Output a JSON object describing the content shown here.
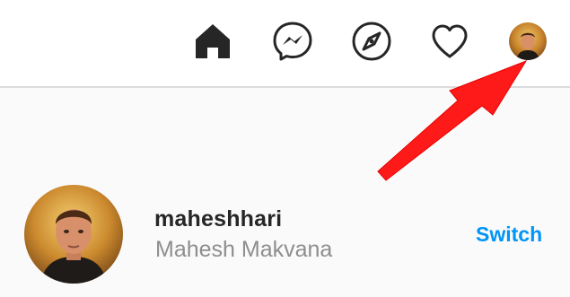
{
  "nav": {
    "icons": [
      "home-icon",
      "messenger-icon",
      "explore-compass-icon",
      "activity-heart-icon",
      "profile-avatar"
    ]
  },
  "profile": {
    "username": "maheshhari",
    "full_name": "Mahesh Makvana",
    "switch_label": "Switch"
  },
  "colors": {
    "link_blue": "#0095f6",
    "arrow_red": "#ff1a1a",
    "text_dark": "#262626",
    "text_gray": "#8e8e8e"
  }
}
